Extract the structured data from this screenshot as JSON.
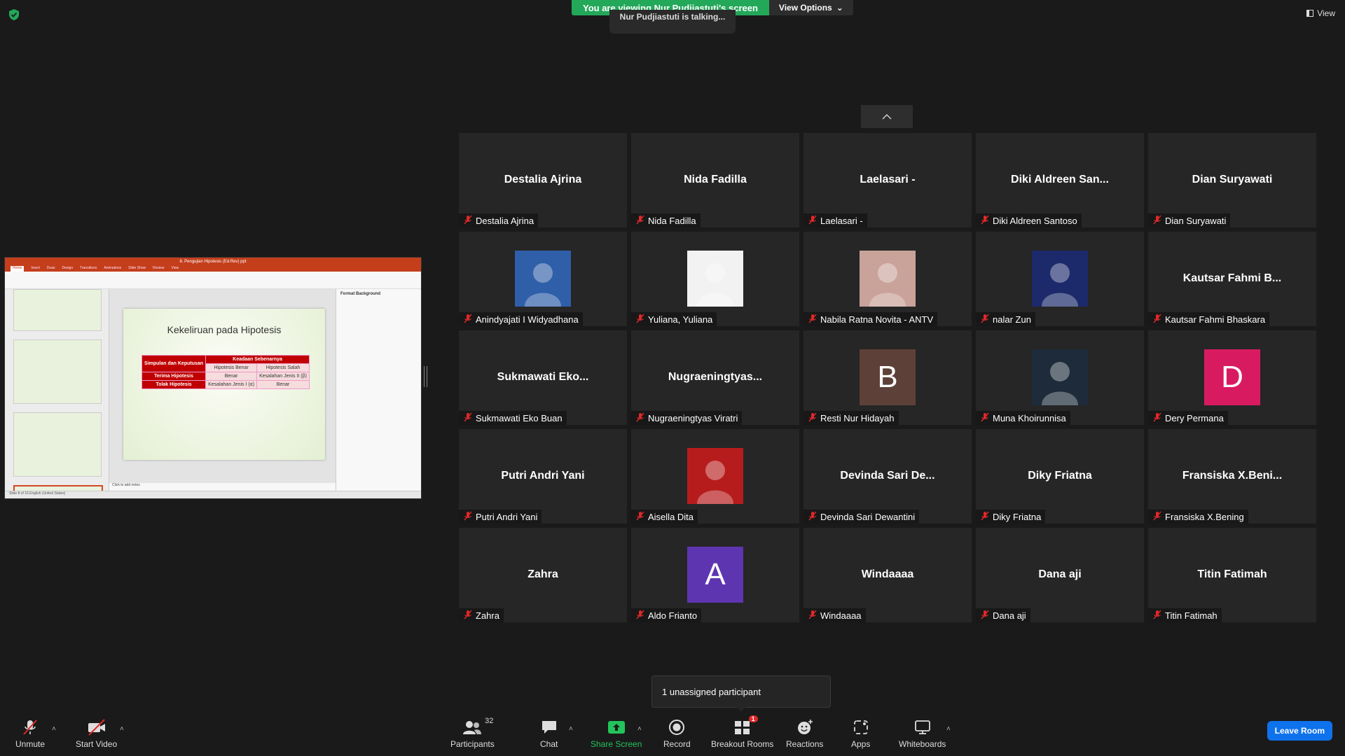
{
  "banner": {
    "viewing_text": "You are viewing Nur Pudjiastuti's screen",
    "view_options": "View Options",
    "talking": "Nur Pudjiastuti is talking..."
  },
  "view_button": "View",
  "shared_screen": {
    "file_name": "8. Pengujian Hipotesis (Ed.Rev) ppt",
    "ribbon_tabs": [
      "Home",
      "Insert",
      "Draw",
      "Design",
      "Transitions",
      "Animations",
      "Slide Show",
      "Review",
      "View"
    ],
    "slide_title": "Kekeliruan pada Hipotesis",
    "table": {
      "header_left": "Simpulan dan Keputusan",
      "header_right": "Keadaan Sebenarnya",
      "col1": "Hipotesis Benar",
      "col2": "Hipotesis Salah",
      "rows": [
        {
          "label": "Terima Hipotesis",
          "a": "Benar",
          "b": "Kesalahan Jenis II (β)"
        },
        {
          "label": "Tolak Hipotesis",
          "a": "Kesalahan Jenis I (α)",
          "b": "Benar"
        }
      ]
    },
    "notes_placeholder": "Click to add notes",
    "format_pane_title": "Format Background",
    "status": "Slide 8 of 16    English (United States)"
  },
  "participants": [
    {
      "display": "Destalia Ajrina",
      "label": "Destalia Ajrina",
      "type": "name"
    },
    {
      "display": "Nida Fadilla",
      "label": "Nida Fadilla",
      "type": "name"
    },
    {
      "display": "Laelasari -",
      "label": "Laelasari -",
      "type": "name"
    },
    {
      "display": "Diki  Aldreen San...",
      "label": "Diki Aldreen Santoso",
      "type": "name"
    },
    {
      "display": "Dian Suryawati",
      "label": "Dian Suryawati",
      "type": "name"
    },
    {
      "display": "",
      "label": "Anindyajati I Widyadhana",
      "type": "photo",
      "photo_bg": "#2f5fa8"
    },
    {
      "display": "",
      "label": "Yuliana, Yuliana",
      "type": "photo",
      "photo_bg": "#f2f2f2"
    },
    {
      "display": "",
      "label": "Nabila Ratna Novita - ANTV",
      "type": "photo",
      "photo_bg": "#c9a39a"
    },
    {
      "display": "",
      "label": "nalar Zun",
      "type": "photo",
      "photo_bg": "#1c2a6b"
    },
    {
      "display": "Kautsar Fahmi B...",
      "label": "Kautsar Fahmi Bhaskara",
      "type": "name"
    },
    {
      "display": "Sukmawati  Eko...",
      "label": "Sukmawati Eko Buan",
      "type": "name"
    },
    {
      "display": "Nugraeningtyas...",
      "label": "Nugraeningtyas Viratri",
      "type": "name"
    },
    {
      "display": "B",
      "label": "Resti Nur Hidayah",
      "type": "avatar",
      "avatar_bg": "#5d4037"
    },
    {
      "display": "",
      "label": "Muna Khoirunnisa",
      "type": "photo",
      "photo_bg": "#1d2b3a"
    },
    {
      "display": "D",
      "label": "Dery Permana",
      "type": "avatar",
      "avatar_bg": "#d81b60"
    },
    {
      "display": "Putri Andri Yani",
      "label": "Putri Andri Yani",
      "type": "name"
    },
    {
      "display": "",
      "label": "Aisella Dita",
      "type": "photo",
      "photo_bg": "#b71c1c"
    },
    {
      "display": "Devinda Sari De...",
      "label": "Devinda Sari Dewantini",
      "type": "name"
    },
    {
      "display": "Diky Friatna",
      "label": "Diky Friatna",
      "type": "name"
    },
    {
      "display": "Fransiska  X.Beni...",
      "label": "Fransiska X.Bening",
      "type": "name"
    },
    {
      "display": "Zahra",
      "label": "Zahra",
      "type": "name"
    },
    {
      "display": "A",
      "label": "Aldo Frianto",
      "type": "avatar",
      "avatar_bg": "#5e35b1"
    },
    {
      "display": "Windaaaa",
      "label": "Windaaaa",
      "type": "name"
    },
    {
      "display": "Dana aji",
      "label": "Dana aji",
      "type": "name"
    },
    {
      "display": "Titin Fatimah",
      "label": "Titin Fatimah",
      "type": "name"
    }
  ],
  "popover": "1 unassigned participant",
  "toolbar": {
    "unmute": "Unmute",
    "start_video": "Start Video",
    "participants": "Participants",
    "participants_count": "32",
    "chat": "Chat",
    "share_screen": "Share Screen",
    "record": "Record",
    "breakout_rooms": "Breakout Rooms",
    "breakout_badge": "1",
    "reactions": "Reactions",
    "apps": "Apps",
    "whiteboards": "Whiteboards",
    "leave_room": "Leave Room"
  },
  "colors": {
    "banner_green": "#23a85a",
    "leave_blue": "#0e72ed",
    "share_green": "#23c35c",
    "muted_red": "#e02828",
    "ppt_orange": "#c43e1c"
  }
}
